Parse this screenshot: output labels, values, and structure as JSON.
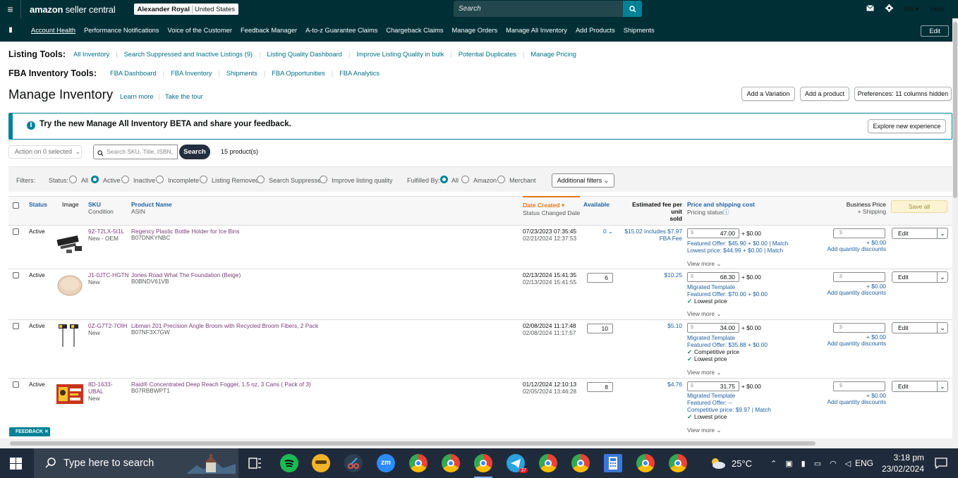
{
  "header": {
    "logo_main": "amazon",
    "logo_sub": " seller central",
    "account_name": "Alexander Royal",
    "account_region": "United States",
    "search_placeholder": "Search",
    "language": "EN",
    "help": "Help"
  },
  "nav": {
    "items": [
      "Account Health",
      "Performance Notifications",
      "Voice of the Customer",
      "Feedback Manager",
      "A-to-z Guarantee Claims",
      "Chargeback Claims",
      "Manage Orders",
      "Manage All Inventory",
      "Add Products",
      "Shipments"
    ],
    "edit": "Edit"
  },
  "listing_tools": {
    "label": "Listing Tools:",
    "links": [
      "All Inventory",
      "Search Suppressed and Inactive Listings (9)",
      "Listing Quality Dashboard",
      "Improve Listing Quality in bulk",
      "Potential Duplicates",
      "Manage Pricing"
    ]
  },
  "fba_tools": {
    "label": "FBA Inventory Tools:",
    "links": [
      "FBA Dashboard",
      "FBA Inventory",
      "Shipments",
      "FBA Opportunities",
      "FBA Analytics"
    ]
  },
  "page": {
    "title": "Manage Inventory",
    "learn_more": "Learn more",
    "tour": "Take the tour",
    "add_variation": "Add a Variation",
    "add_product": "Add a product",
    "preferences": "Preferences: 11 columns hidden"
  },
  "banner": {
    "text": "Try the new Manage All Inventory BETA and share your feedback.",
    "button": "Explore new experience"
  },
  "toolbar": {
    "action": "Action on 0 selected",
    "search_placeholder": "Search SKU, Title, ISBN,",
    "search_btn": "Search",
    "count": "15 product(s)"
  },
  "filters": {
    "label": "Filters:",
    "status_label": "Status:",
    "status_options": [
      "All",
      "Active",
      "Inactive",
      "Incomplete",
      "Listing Removed",
      "Search Suppressed",
      "Improve listing quality"
    ],
    "status_selected": "Active",
    "fulfilled_label": "Fulfilled By:",
    "fulfilled_options": [
      "All",
      "Amazon",
      "Merchant"
    ],
    "fulfilled_selected": "All",
    "additional": "Additional filters"
  },
  "columns": {
    "status": "Status",
    "image": "Image",
    "sku": "SKU",
    "condition": "Condition",
    "product_name": "Product Name",
    "asin": "ASIN",
    "date_created": "Date Created",
    "status_changed": "Status Changed Date",
    "available": "Available",
    "fee_1": "Estimated fee per unit",
    "fee_2": "sold",
    "price": "Price and shipping cost",
    "pricing_status": "Pricing status",
    "business_price": "Business Price",
    "shipping": "+ Shipping",
    "save_all": "Save all"
  },
  "rows": [
    {
      "status": "Active",
      "sku": "9Z-T2LX-5I1L",
      "condition": "New - OEM",
      "name": "Regency Plastic Bottle Holder for Ice Bins",
      "asin": "B07DNKYNBC",
      "date_created": "07/23/2023 07:35:45",
      "date_changed": "02/21/2024 12:37:53",
      "available": "0",
      "fee": "$15.02 Includes $7.97",
      "fee2": "FBA Fee",
      "price": "47.00",
      "ship": "+ $0.00",
      "lines": [
        "Featured Offer: $45.90 + $0.00 | Match",
        "Lowest price: $44.99 + $0.00 | Match"
      ],
      "view_more": "View more",
      "biz_ship": "+ $0.00",
      "qty_disc": "Add quantity discounts",
      "edit": "Edit"
    },
    {
      "status": "Active",
      "sku": "J1-0JTC-HGTN",
      "condition": "New",
      "name": "Jones Road What The Foundation (Beige)",
      "asin": "B0BNDV61VB",
      "date_created": "02/13/2024 15:41:35",
      "date_changed": "02/13/2024 15:41:55",
      "available": "6",
      "fee": "$10.25",
      "fee2": "",
      "price": "68.30",
      "ship": "+ $0.00",
      "lines": [
        "Migrated Template",
        "Featured Offer: $70.00 + $0.00",
        "✓ Lowest price"
      ],
      "view_more": "View more",
      "biz_ship": "+ $0.00",
      "qty_disc": "Add quantity discounts",
      "edit": "Edit"
    },
    {
      "status": "Active",
      "sku": "0Z-G7T2-7OIH",
      "condition": "New",
      "name": "Libman 201 Precision Angle Broom with Recycled Broom Fibers, 2 Pack",
      "asin": "B07NF3X7GW",
      "date_created": "02/08/2024 11:17:48",
      "date_changed": "02/08/2024 11:17:57",
      "available": "10",
      "fee": "$5.10",
      "fee2": "",
      "price": "34.00",
      "ship": "+ $0.00",
      "lines": [
        "Migrated Template",
        "Featured Offer: $35.88 + $0.00",
        "✓ Competitive price",
        "✓ Lowest price"
      ],
      "view_more": "View more",
      "biz_ship": "+ $0.00",
      "qty_disc": "Add quantity discounts",
      "edit": "Edit"
    },
    {
      "status": "Active",
      "sku": "8D-1633-",
      "sku2": "UBAL",
      "condition": "New",
      "name": "Raid® Concentrated Deep Reach Fogger, 1.5 oz, 3 Cans ( Pack of 3)",
      "asin": "B07RBBWPT1",
      "date_created": "01/12/2024 12:10:13",
      "date_changed": "02/05/2024 13:46:28",
      "available": "8",
      "fee": "$4.76",
      "fee2": "",
      "price": "31.75",
      "ship": "+ $0.00",
      "lines": [
        "Migrated Template",
        "Featured Offer: --",
        "Competitive price: $9.97 | Match",
        "✓ Lowest price"
      ],
      "view_more": "View more",
      "biz_ship": "+ $0.00",
      "qty_disc": "Add quantity discounts",
      "edit": "Edit"
    }
  ],
  "feedback": "FEEDBACK",
  "taskbar": {
    "search": "Type here to search",
    "weather": "25°C",
    "lang": "ENG",
    "time": "3:18 pm",
    "date": "23/02/2024",
    "telegram_badge": "37"
  },
  "colors": {
    "header_bg": "#002f36",
    "accent": "#008296",
    "link": "#007185",
    "taskbar": "#1f2b3a"
  }
}
